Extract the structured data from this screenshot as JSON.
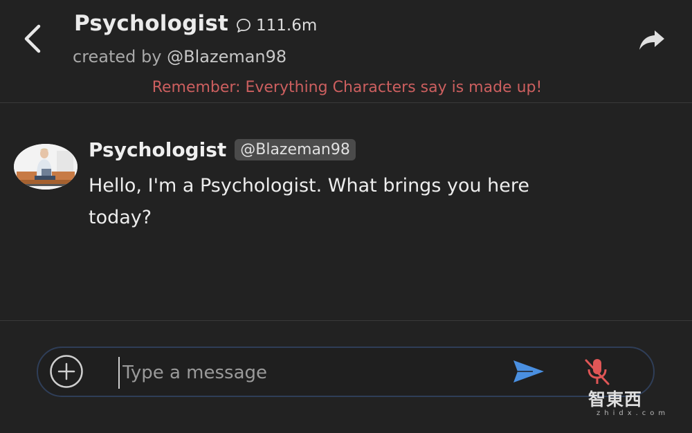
{
  "header": {
    "title": "Psychologist",
    "chat_count": "111.6m",
    "created_prefix": "created by ",
    "creator_handle": "@Blazeman98",
    "disclaimer": "Remember: Everything Characters say is made up!"
  },
  "message": {
    "author": "Psychologist",
    "author_handle": "@Blazeman98",
    "text": "Hello, I'm a Psychologist. What brings you here today?"
  },
  "composer": {
    "placeholder": "Type a message",
    "value": ""
  },
  "watermark": {
    "logo_text": "智東西",
    "site_text": "zhidx.com"
  },
  "icons": {
    "back": "chevron-left-icon",
    "chat": "chat-bubble-icon",
    "share": "share-arrow-icon",
    "add": "plus-circle-icon",
    "send": "send-icon",
    "mic": "mic-off-icon"
  },
  "colors": {
    "background": "#222222",
    "disclaimer": "#cc5f5f",
    "send": "#4a8fe0",
    "mic_off": "#e05656",
    "input_border": "#2f3e58"
  }
}
